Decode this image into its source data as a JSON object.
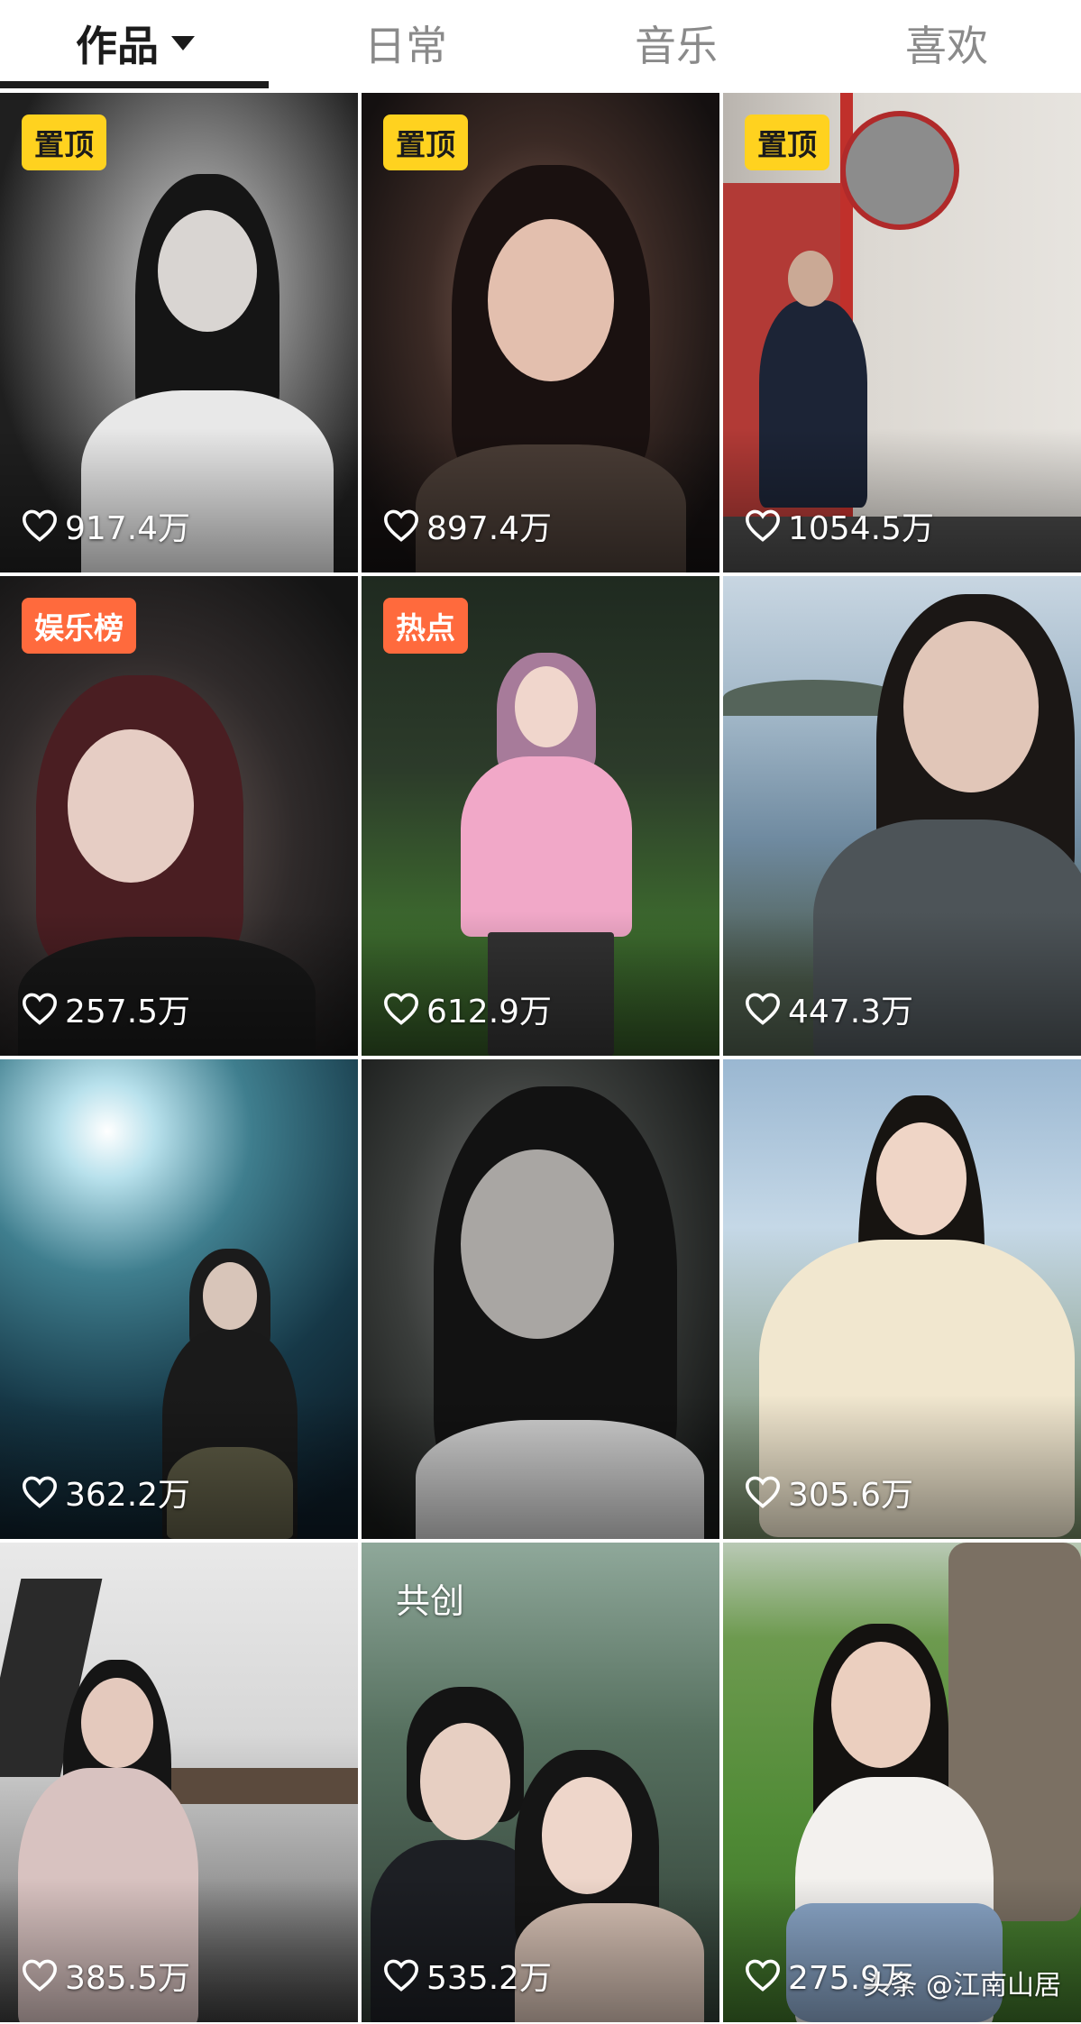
{
  "tabs": [
    {
      "label": "作品",
      "active": true
    },
    {
      "label": "日常",
      "active": false
    },
    {
      "label": "音乐",
      "active": false
    },
    {
      "label": "喜欢",
      "active": false
    }
  ],
  "icons": {
    "caret": "caret-down-icon",
    "heart": "heart-outline-icon"
  },
  "colors": {
    "badge_top": "#ffd21f",
    "badge_hot": "#ff6a3d"
  },
  "videos": [
    {
      "badge": "置顶",
      "likes": "917.4万"
    },
    {
      "badge": "置顶",
      "likes": "897.4万"
    },
    {
      "badge": "置顶",
      "likes": "1054.5万"
    },
    {
      "badge": "娱乐榜",
      "likes": "257.5万"
    },
    {
      "badge": "热点",
      "likes": "612.9万"
    },
    {
      "likes": "447.3万"
    },
    {
      "likes": "362.2万"
    },
    {
      "likes": ""
    },
    {
      "likes": "305.6万"
    },
    {
      "likes": "385.5万"
    },
    {
      "badge": "共创",
      "likes": "535.2万"
    },
    {
      "likes": "275.9万"
    }
  ],
  "watermark": "头条 @江南山居"
}
